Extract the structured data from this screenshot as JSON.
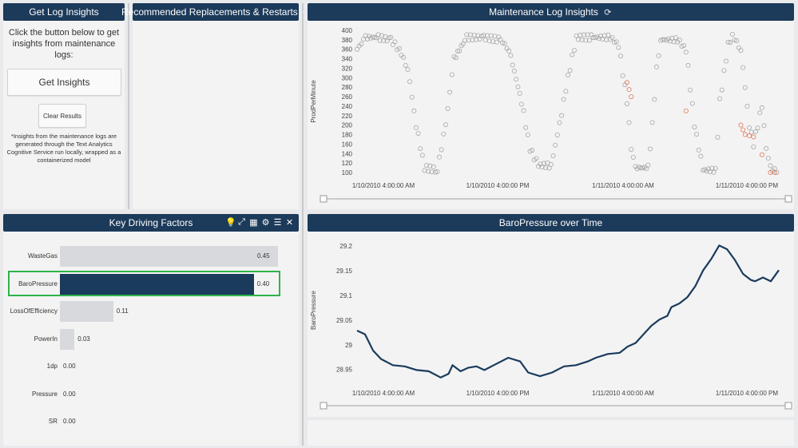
{
  "left_panel": {
    "title": "Get Log Insights",
    "intro": "Click the button below to get insights from maintenance logs:",
    "get_button": "Get Insights",
    "clear_button": "Clear Results",
    "note": "*Insights from the maintenance logs are generated through the Text Analytics Cognitive Service run locally, wrapped as a containerized model"
  },
  "rec_panel": {
    "title": "Recommended Replacements & Restarts",
    "refresh_icon": "refresh-icon"
  },
  "mli_panel": {
    "title": "Maintenance Log Insights",
    "refresh_icon": "refresh-icon"
  },
  "kdf_panel": {
    "title": "Key Driving Factors",
    "toolbar_icons": [
      "lightbulb-icon",
      "expand-icon",
      "table-icon",
      "gear-icon",
      "list-icon",
      "close-icon"
    ],
    "highlight_color": "#2fb34a",
    "bar_color": "#d7d9dc",
    "selected_bar_color": "#1a3b5c",
    "rows": [
      {
        "label": "WasteGas",
        "value": "0.45"
      },
      {
        "label": "BaroPressure",
        "value": "0.40",
        "selected": true
      },
      {
        "label": "LossOfEfficiency",
        "value": "0.11"
      },
      {
        "label": "PowerIn",
        "value": "0.03"
      },
      {
        "label": "1dp",
        "value": "0.00"
      },
      {
        "label": "Pressure",
        "value": "0.00"
      },
      {
        "label": "SR",
        "value": "0.00"
      }
    ]
  },
  "baro_panel": {
    "title": "BaroPressure over Time"
  },
  "chart_data": [
    {
      "type": "scatter",
      "ylabel": "ProdPerMinute",
      "y_ticks": [
        "400",
        "380",
        "360",
        "340",
        "320",
        "300",
        "280",
        "260",
        "240",
        "220",
        "200",
        "180",
        "160",
        "140",
        "120",
        "100"
      ],
      "ylim": [
        100,
        400
      ],
      "x_ticks": [
        "1/10/2010 4:00:00 AM",
        "1/10/2010 4:00:00 PM",
        "1/11/2010 4:00:00 AM",
        "1/11/2010 4:00:00 PM"
      ],
      "series": [
        {
          "color": "#9a9a9a",
          "values": [
            [
              0,
              360
            ],
            [
              0.02,
              385
            ],
            [
              0.05,
              385
            ],
            [
              0.08,
              380
            ],
            [
              0.1,
              360
            ],
            [
              0.12,
              320
            ],
            [
              0.14,
              200
            ],
            [
              0.16,
              110
            ],
            [
              0.19,
              105
            ],
            [
              0.21,
              200
            ],
            [
              0.23,
              340
            ],
            [
              0.26,
              385
            ],
            [
              0.3,
              385
            ],
            [
              0.34,
              380
            ],
            [
              0.36,
              360
            ],
            [
              0.39,
              250
            ],
            [
              0.41,
              150
            ],
            [
              0.43,
              115
            ],
            [
              0.46,
              115
            ],
            [
              0.48,
              200
            ],
            [
              0.5,
              300
            ],
            [
              0.52,
              385
            ],
            [
              0.56,
              385
            ],
            [
              0.6,
              385
            ],
            [
              0.62,
              370
            ],
            [
              0.64,
              250
            ],
            [
              0.65,
              150
            ],
            [
              0.66,
              110
            ],
            [
              0.69,
              110
            ],
            [
              0.7,
              200
            ],
            [
              0.71,
              320
            ],
            [
              0.72,
              380
            ],
            [
              0.76,
              380
            ],
            [
              0.78,
              360
            ],
            [
              0.8,
              200
            ],
            [
              0.82,
              105
            ],
            [
              0.85,
              105
            ],
            [
              0.86,
              250
            ],
            [
              0.88,
              370
            ],
            [
              0.89,
              390
            ],
            [
              0.91,
              360
            ],
            [
              0.93,
              200
            ],
            [
              0.94,
              160
            ],
            [
              0.96,
              240
            ],
            [
              0.97,
              150
            ],
            [
              0.98,
              110
            ],
            [
              1.0,
              100
            ]
          ]
        },
        {
          "color": "#e0603a",
          "values": [
            [
              0.64,
              290
            ],
            [
              0.65,
              260
            ],
            [
              0.91,
              200
            ],
            [
              0.92,
              180
            ],
            [
              0.94,
              175
            ],
            [
              0.98,
              100
            ],
            [
              1.0,
              100
            ]
          ]
        }
      ]
    },
    {
      "type": "line",
      "ylabel": "BaroPressure",
      "y_ticks": [
        "29.2",
        "29.15",
        "29.1",
        "29.05",
        "29",
        "28.95"
      ],
      "ylim": [
        28.93,
        29.21
      ],
      "x_ticks": [
        "1/10/2010 4:00:00 AM",
        "1/10/2010 4:00:00 PM",
        "1/11/2010 4:00:00 AM",
        "1/11/2010 4:00:00 PM"
      ],
      "color": "#1a3b5c",
      "series": [
        {
          "values": [
            [
              0,
              29.03
            ],
            [
              0.02,
              29.02
            ],
            [
              0.04,
              28.99
            ],
            [
              0.06,
              28.97
            ],
            [
              0.09,
              28.96
            ],
            [
              0.12,
              28.955
            ],
            [
              0.15,
              28.95
            ],
            [
              0.18,
              28.945
            ],
            [
              0.21,
              28.935
            ],
            [
              0.23,
              28.94
            ],
            [
              0.24,
              28.96
            ],
            [
              0.26,
              28.945
            ],
            [
              0.28,
              28.955
            ],
            [
              0.3,
              28.955
            ],
            [
              0.32,
              28.95
            ],
            [
              0.35,
              28.96
            ],
            [
              0.38,
              28.975
            ],
            [
              0.41,
              28.965
            ],
            [
              0.43,
              28.945
            ],
            [
              0.46,
              28.935
            ],
            [
              0.49,
              28.945
            ],
            [
              0.52,
              28.955
            ],
            [
              0.55,
              28.96
            ],
            [
              0.58,
              28.965
            ],
            [
              0.6,
              28.975
            ],
            [
              0.63,
              28.98
            ],
            [
              0.66,
              28.985
            ],
            [
              0.68,
              28.995
            ],
            [
              0.7,
              29.005
            ],
            [
              0.72,
              29.02
            ],
            [
              0.74,
              29.04
            ],
            [
              0.76,
              29.05
            ],
            [
              0.78,
              29.06
            ],
            [
              0.79,
              29.075
            ],
            [
              0.81,
              29.085
            ],
            [
              0.83,
              29.095
            ],
            [
              0.85,
              29.12
            ],
            [
              0.87,
              29.15
            ],
            [
              0.89,
              29.175
            ],
            [
              0.91,
              29.2
            ],
            [
              0.93,
              29.195
            ],
            [
              0.95,
              29.17
            ],
            [
              0.97,
              29.145
            ],
            [
              0.99,
              29.13
            ],
            [
              1.0,
              29.13
            ],
            [
              1.02,
              29.135
            ],
            [
              1.04,
              29.13
            ],
            [
              1.06,
              29.15
            ]
          ]
        }
      ]
    }
  ]
}
